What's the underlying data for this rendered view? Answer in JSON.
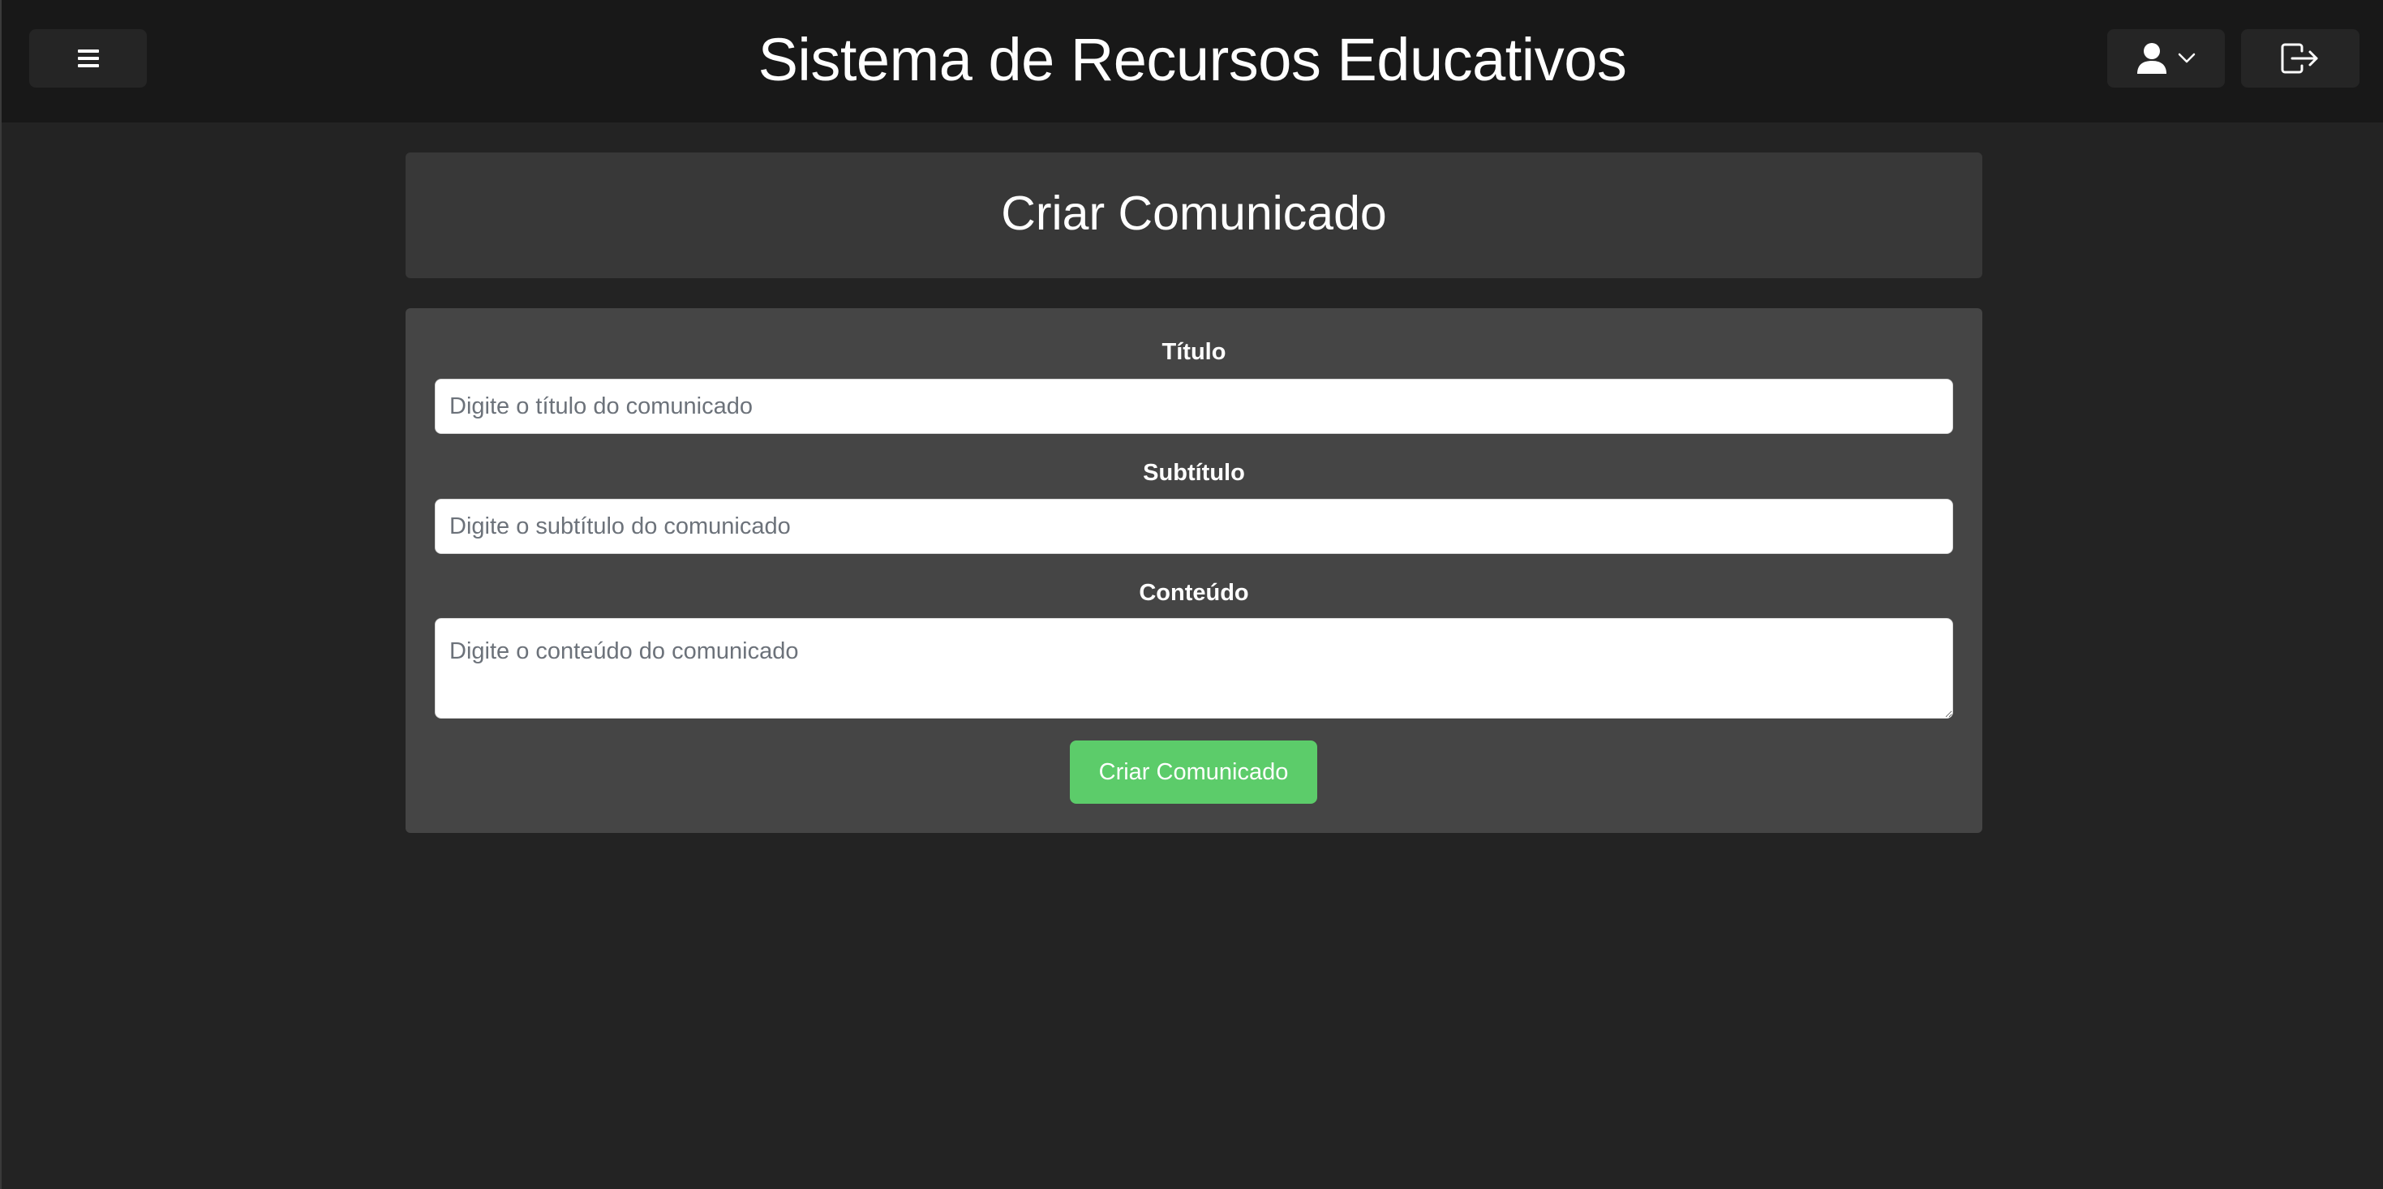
{
  "header": {
    "app_title": "Sistema de Recursos Educativos",
    "menu_icon": "hamburger-menu-icon",
    "user_icon": "user-icon",
    "dropdown_icon": "chevron-down-icon",
    "logout_icon": "logout-icon"
  },
  "page": {
    "title": "Criar Comunicado"
  },
  "form": {
    "title_field": {
      "label": "Título",
      "placeholder": "Digite o título do comunicado",
      "value": ""
    },
    "subtitle_field": {
      "label": "Subtítulo",
      "placeholder": "Digite o subtítulo do comunicado",
      "value": ""
    },
    "content_field": {
      "label": "Conteúdo",
      "placeholder": "Digite o conteúdo do comunicado",
      "value": ""
    },
    "submit_label": "Criar Comunicado"
  },
  "colors": {
    "background": "#232323",
    "navbar": "#181818",
    "header_card": "#383838",
    "form_card": "#454545",
    "submit_button": "#5ccc6a"
  }
}
